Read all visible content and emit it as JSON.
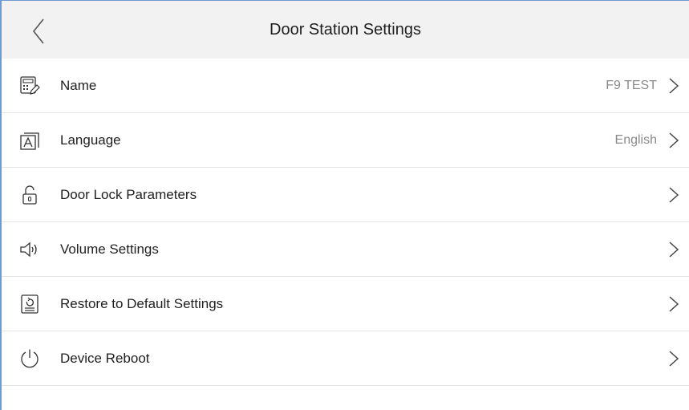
{
  "header": {
    "title": "Door Station Settings",
    "back_icon": "chevron-left-icon"
  },
  "settings": [
    {
      "label": "Name",
      "value": "F9 TEST",
      "icon": "keypad-edit-icon"
    },
    {
      "label": "Language",
      "value": "English",
      "icon": "language-icon"
    },
    {
      "label": "Door Lock Parameters",
      "value": "",
      "icon": "lock-icon"
    },
    {
      "label": "Volume Settings",
      "value": "",
      "icon": "speaker-icon"
    },
    {
      "label": "Restore to Default Settings",
      "value": "",
      "icon": "restore-device-icon"
    },
    {
      "label": "Device Reboot",
      "value": "",
      "icon": "power-icon"
    }
  ],
  "colors": {
    "header_bg": "#f2f2f2",
    "divider": "#e3e3e3",
    "value_text": "#8a8a8a",
    "frame_border": "#6f9bd1"
  }
}
